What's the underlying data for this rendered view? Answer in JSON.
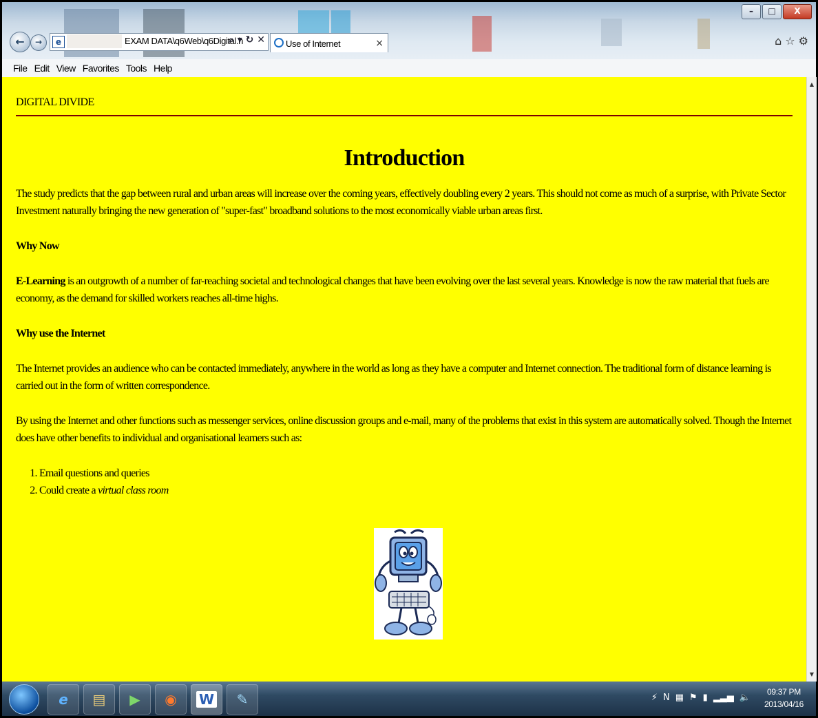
{
  "browser": {
    "address_url": "EXAM DATA\\q6Web\\q6Digital.h",
    "address_controls": "⌕ ▾ ↻ ✕",
    "tab_title": "Use of Internet",
    "tab_close": "×",
    "window_controls": {
      "minimize": "–",
      "maximize": "□",
      "close": "X"
    },
    "right_icons": [
      "⌂",
      "☆",
      "⚙"
    ]
  },
  "menu": [
    "File",
    "Edit",
    "View",
    "Favorites",
    "Tools",
    "Help"
  ],
  "page": {
    "site_title": "DIGITAL DIVIDE",
    "heading": "Introduction",
    "para1": "The study predicts that the gap between rural and urban areas will increase over the coming years, effectively doubling every 2 years. This should not come as much of a surprise, with Private Sector Investment naturally bringing the new generation of \"super-fast\" broadband solutions to the most economically viable urban areas first.",
    "why_now": "Why Now",
    "elearning_bold": "E-Learning",
    "elearning_rest": " is an outgrowth of a number of far-reaching societal and technological changes that have been evolving over the last several years. Knowledge is now the raw material that fuels are economy, as the demand for skilled workers reaches all-time highs.",
    "why_internet": "Why use the Internet",
    "para3": "The Internet provides an audience who can be contacted immediately, anywhere in the world as long as they have a computer and Internet connection. The traditional form of distance learning is carried out in the form of written correspondence.",
    "para4": "By using the Internet and other functions such as messenger services, online discussion groups and e-mail, many of the problems that exist in this system are automatically solved. Though the Internet does have other benefits to individual and organisational learners such as:",
    "list_item1": "Email questions and queries",
    "list_item2_prefix": "Could create a ",
    "list_item2_italic": "virtual class room"
  },
  "taskbar": {
    "apps": [
      "ie-icon",
      "file-explorer-icon",
      "media-player-icon",
      "powerpoint-icon",
      "word-icon",
      "notepad-icon"
    ],
    "word_label": "W",
    "tray_icons": [
      "⚡",
      "N",
      "▦",
      "⚑",
      "▮",
      "▂▃▅",
      "🔈"
    ],
    "time": "09:37 PM",
    "date": "2013/04/16"
  }
}
